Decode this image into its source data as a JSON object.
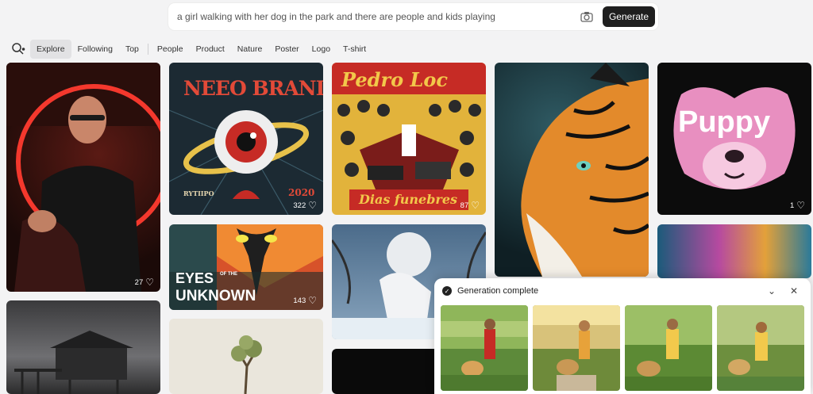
{
  "search": {
    "value": "a girl walking with her dog in the park and there are people and kids playing",
    "generate_label": "Generate"
  },
  "tabs": [
    {
      "label": "Explore",
      "active": true
    },
    {
      "label": "Following"
    },
    {
      "label": "Top"
    },
    {
      "label": "People"
    },
    {
      "label": "Product"
    },
    {
      "label": "Nature"
    },
    {
      "label": "Poster"
    },
    {
      "label": "Logo"
    },
    {
      "label": "T-shirt"
    }
  ],
  "cards": {
    "man": {
      "likes": "27"
    },
    "neeo": {
      "title": "NEEO BRAND",
      "left_tag": "RYTIIPO",
      "year": "2020",
      "likes": "322"
    },
    "pedro": {
      "title": "Pedro Loc",
      "subtitle": "Dias funebres",
      "likes": "87"
    },
    "puppy": {
      "title": "Puppy",
      "likes": "1"
    },
    "eyes": {
      "line1": "EYES",
      "line2": "OF THE",
      "line3": "UNKNOWN",
      "likes": "143"
    }
  },
  "toast": {
    "title": "Generation complete"
  },
  "icons": {
    "search": "search-icon",
    "camera": "camera-icon",
    "heart": "heart-icon",
    "chevron": "chevron-down-icon",
    "close": "close-icon",
    "check": "check-circle-icon"
  }
}
